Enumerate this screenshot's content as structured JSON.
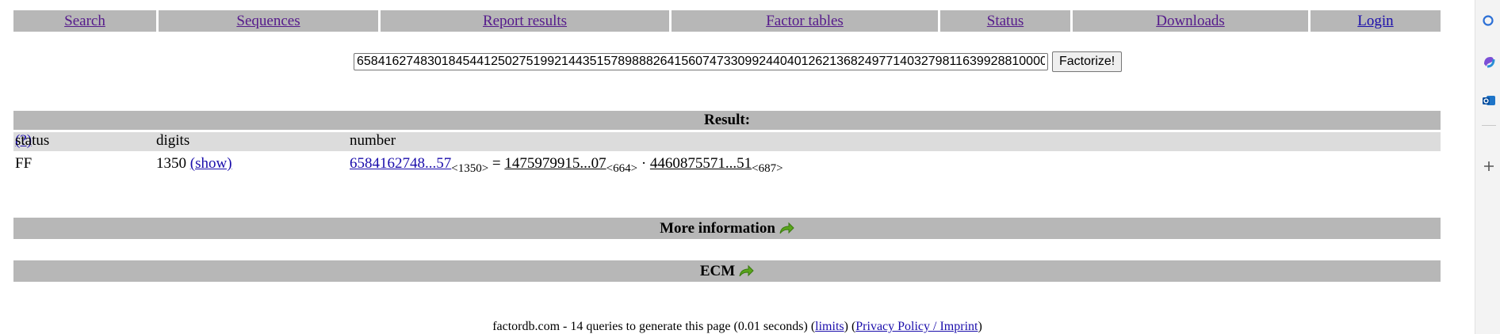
{
  "nav": {
    "search": "Search",
    "sequences": "Sequences",
    "report": "Report results",
    "factor_tables": "Factor tables",
    "status": "Status",
    "downloads": "Downloads",
    "login": "Login"
  },
  "search": {
    "value": "65841627483018454412502751992144351578988826415607473309924404012621368249771403279811639928810000",
    "button_label": "Factorize!"
  },
  "result": {
    "title": "Result:",
    "col_status": "status",
    "help_link": "(?)",
    "col_digits": "digits",
    "col_number": "number",
    "status_value": "FF",
    "digits_value": "1350",
    "show_link": "(show)",
    "number_link": "6584162748...57",
    "number_sub": "<1350>",
    "equals": " = ",
    "factor1_link": "1475979915...07",
    "factor1_sub": "<664>",
    "dot": " · ",
    "factor2_link": "4460875571...51",
    "factor2_sub": "<687>"
  },
  "more_info": "More information",
  "ecm": "ECM",
  "footer": {
    "text_before": "factordb.com - 14 queries to generate this page (0.01 seconds) (",
    "limits": "limits",
    "middle": ") (",
    "privacy": "Privacy Policy / Imprint",
    "end": ")"
  },
  "colors": {
    "bar": "#b7b7b7",
    "subbar": "#dcdcdc",
    "link": "#1a0dab",
    "visited": "#551a8b",
    "arrow": "#5aa51c"
  }
}
